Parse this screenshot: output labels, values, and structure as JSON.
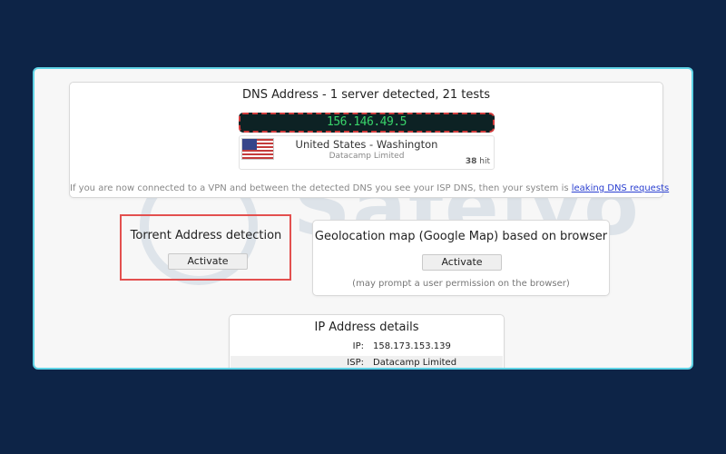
{
  "dns": {
    "title": "DNS Address - 1 server detected, 21 tests",
    "ip": "156.146.49.5",
    "location": "United States - Washington",
    "isp": "Datacamp Limited",
    "hits_count": "38",
    "hits_label": "hit",
    "note_text": "If you are now connected to a VPN and between the detected DNS you see your ISP DNS, then your system is",
    "note_link": "leaking DNS requests"
  },
  "torrent": {
    "title": "Torrent Address detection",
    "button": "Activate"
  },
  "geo": {
    "title": "Geolocation map (Google Map) based on browser",
    "button": "Activate",
    "subtitle": "(may prompt a user permission on the browser)"
  },
  "ip_details": {
    "title": "IP Address details",
    "rows": [
      {
        "label": "IP:",
        "value": "158.173.153.139"
      },
      {
        "label": "ISP:",
        "value": "Datacamp Limited"
      }
    ]
  },
  "watermark": {
    "text": "Safelyo"
  },
  "colors": {
    "page_bg": "#0d2447",
    "frame_border": "#5fd3e6",
    "highlight_red": "#e3504f",
    "ip_green": "#39d36a",
    "link_blue": "#2a3fd0"
  }
}
